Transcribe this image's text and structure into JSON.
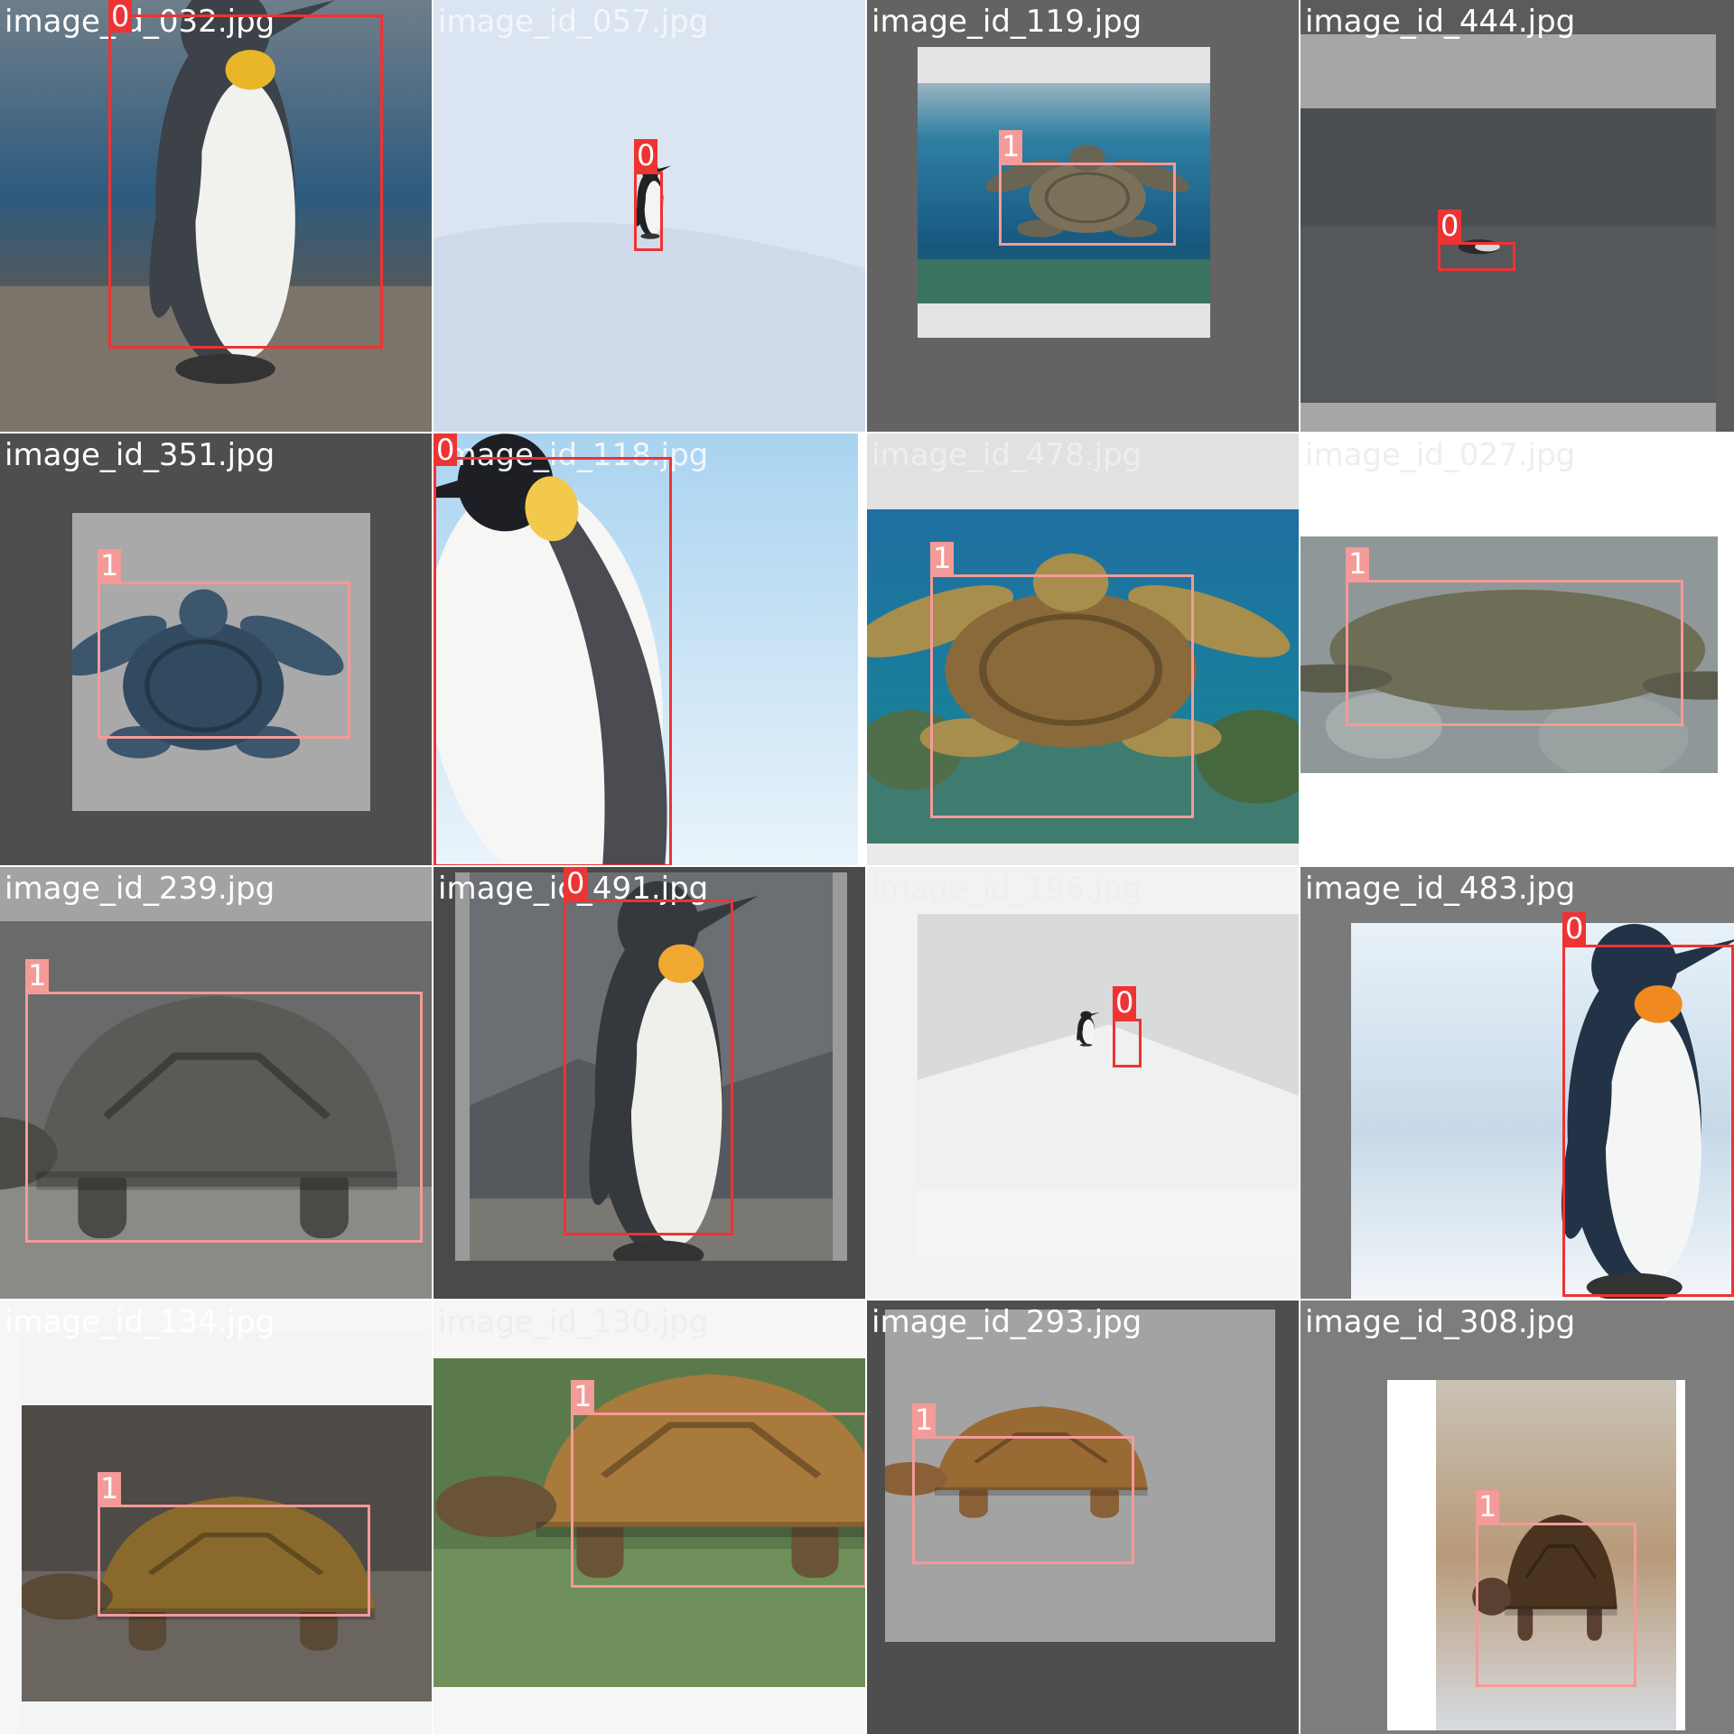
{
  "colors": {
    "class_0": "#ee3333",
    "class_1": "#f49a98",
    "label_text": "#ffffff"
  },
  "classes": [
    {
      "id": 0,
      "label": "0",
      "color": "#ee3333"
    },
    {
      "id": 1,
      "label": "1",
      "color": "#f49a98"
    }
  ],
  "tiles": [
    {
      "filename": "image_id_032.jpg",
      "filename_color": "#ffffff",
      "scene": "penguin-rocks",
      "detections": [
        {
          "class_id": 0,
          "label": "0"
        }
      ]
    },
    {
      "filename": "image_id_057.jpg",
      "filename_color": "#f3f6fb",
      "scene": "penguin-ice-far",
      "detections": [
        {
          "class_id": 0,
          "label": "0"
        }
      ]
    },
    {
      "filename": "image_id_119.jpg",
      "filename_color": "#ffffff",
      "scene": "sea-turtle-surface",
      "detections": [
        {
          "class_id": 1,
          "label": "1"
        }
      ]
    },
    {
      "filename": "image_id_444.jpg",
      "filename_color": "#ffffff",
      "scene": "penguin-dark-beach",
      "detections": [
        {
          "class_id": 0,
          "label": "0"
        }
      ]
    },
    {
      "filename": "image_id_351.jpg",
      "filename_color": "#ffffff",
      "scene": "plush-turtle",
      "detections": [
        {
          "class_id": 1,
          "label": "1"
        }
      ]
    },
    {
      "filename": "image_id_118.jpg",
      "filename_color": "#f0f6fb",
      "scene": "emperor-penguin",
      "detections": [
        {
          "class_id": 0,
          "label": "0"
        }
      ]
    },
    {
      "filename": "image_id_478.jpg",
      "filename_color": "#eeeeee",
      "scene": "sea-turtle-reef",
      "detections": [
        {
          "class_id": 1,
          "label": "1"
        }
      ]
    },
    {
      "filename": "image_id_027.jpg",
      "filename_color": "#eeeeee",
      "scene": "sea-turtle-rocks",
      "detections": [
        {
          "class_id": 1,
          "label": "1"
        }
      ]
    },
    {
      "filename": "image_id_239.jpg",
      "filename_color": "#ffffff",
      "scene": "giant-tortoise",
      "detections": [
        {
          "class_id": 1,
          "label": "1"
        }
      ]
    },
    {
      "filename": "image_id_491.jpg",
      "filename_color": "#ffffff",
      "scene": "king-penguin-grey",
      "detections": [
        {
          "class_id": 0,
          "label": "0"
        }
      ]
    },
    {
      "filename": "image_id_196.jpg",
      "filename_color": "#eeeeee",
      "scene": "penguin-snow-ridge",
      "detections": [
        {
          "class_id": 0,
          "label": "0"
        }
      ]
    },
    {
      "filename": "image_id_483.jpg",
      "filename_color": "#ffffff",
      "scene": "king-penguin-snow",
      "detections": [
        {
          "class_id": 0,
          "label": "0"
        }
      ]
    },
    {
      "filename": "image_id_134.jpg",
      "filename_color": "#ffffff",
      "scene": "box-turtle",
      "detections": [
        {
          "class_id": 1,
          "label": "1"
        }
      ]
    },
    {
      "filename": "image_id_130.jpg",
      "filename_color": "#eeeeee",
      "scene": "tortoise-grass",
      "detections": [
        {
          "class_id": 1,
          "label": "1"
        }
      ]
    },
    {
      "filename": "image_id_293.jpg",
      "filename_color": "#ffffff",
      "scene": "small-tortoise",
      "detections": [
        {
          "class_id": 1,
          "label": "1"
        }
      ]
    },
    {
      "filename": "image_id_308.jpg",
      "filename_color": "#ffffff",
      "scene": "turtle-blurry",
      "detections": [
        {
          "class_id": 1,
          "label": "1"
        }
      ]
    }
  ]
}
